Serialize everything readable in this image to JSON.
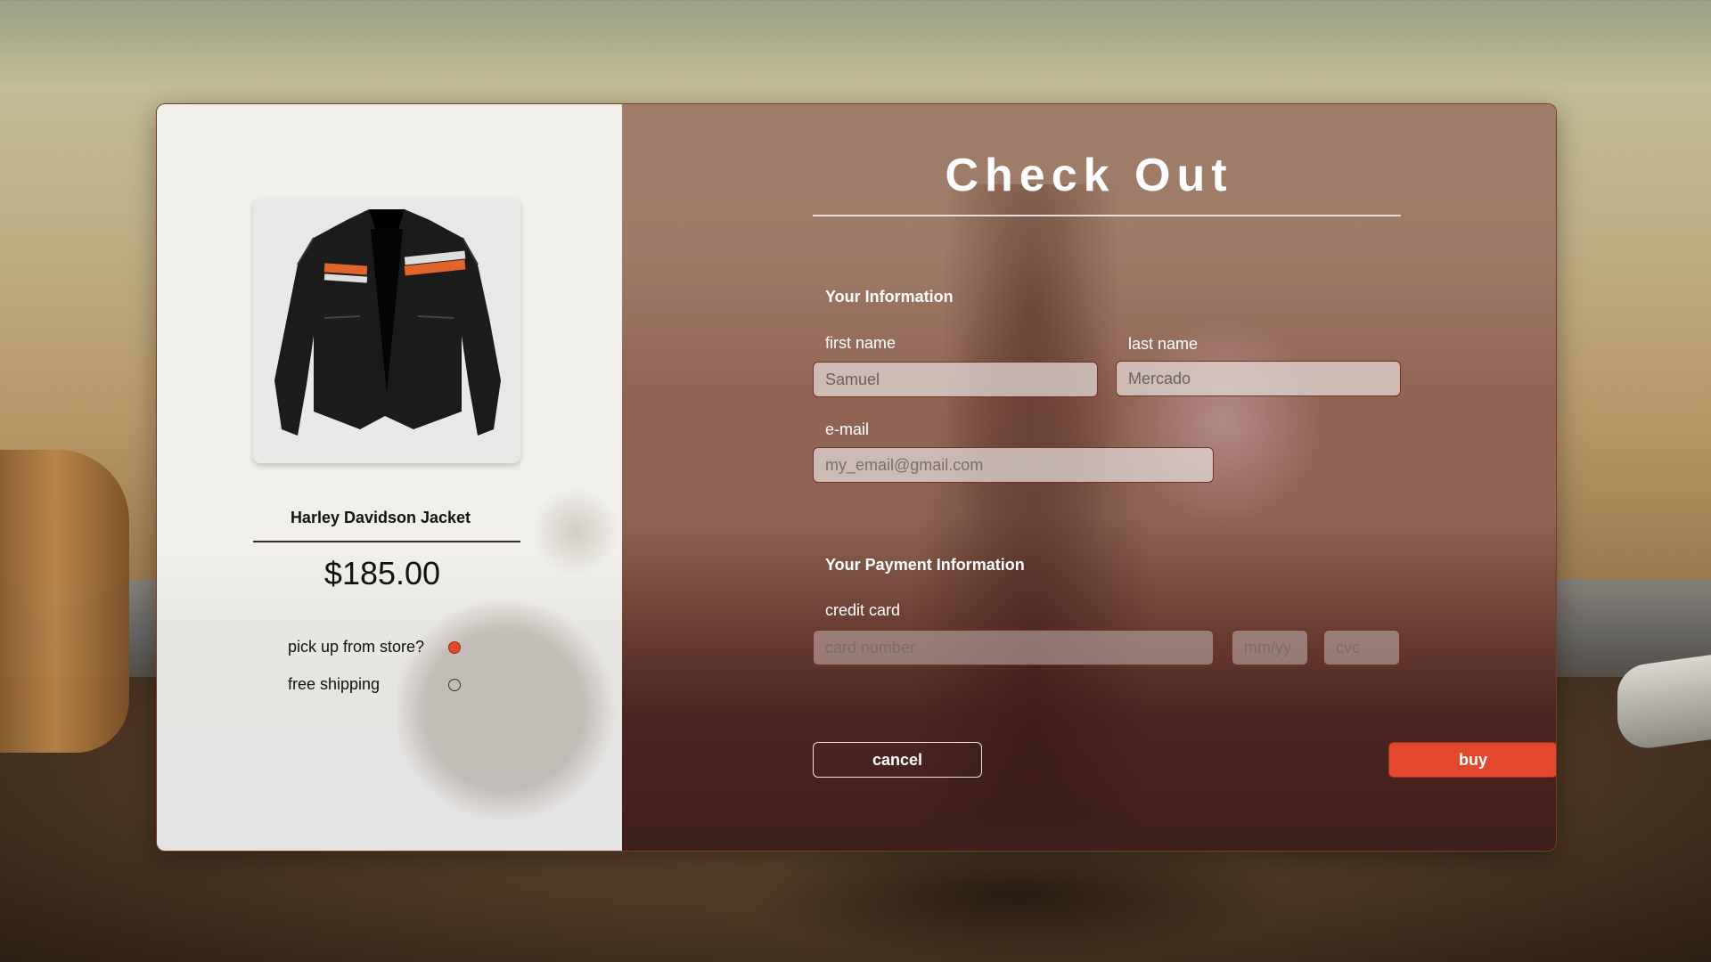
{
  "product": {
    "name": "Harley Davidson Jacket",
    "price": "$185.00",
    "options": [
      {
        "label": "pick up from store?",
        "selected": true
      },
      {
        "label": "free shipping",
        "selected": false
      }
    ]
  },
  "checkout": {
    "title": "Check Out",
    "info_section": "Your Information",
    "payment_section": "Your Payment Information",
    "fields": {
      "first_name": {
        "label": "first name",
        "value": "Samuel"
      },
      "last_name": {
        "label": "last name",
        "value": "Mercado"
      },
      "email": {
        "label": "e-mail",
        "placeholder": "my_email@gmail.com"
      },
      "credit_card": {
        "label": "credit card",
        "placeholder": "card number"
      },
      "expiry": {
        "placeholder": "mm/yy"
      },
      "cvc": {
        "placeholder": "cvc"
      }
    },
    "buttons": {
      "cancel": "cancel",
      "buy": "buy"
    }
  },
  "colors": {
    "accent": "#e3482c",
    "border": "#7a3a26"
  }
}
